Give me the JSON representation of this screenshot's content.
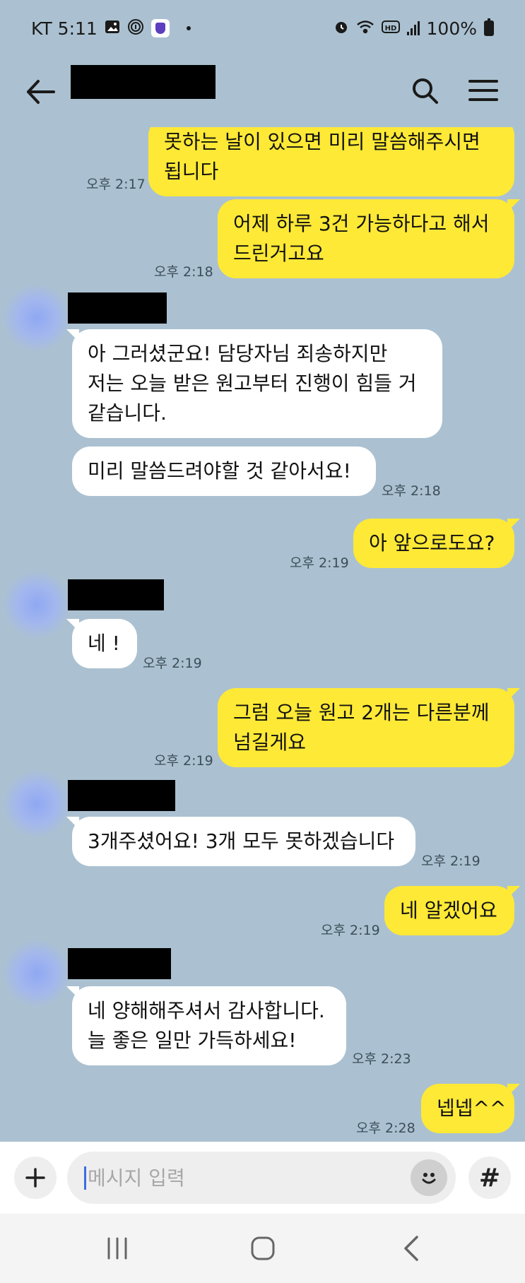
{
  "status_bar": {
    "carrier_time": "KT 5:11",
    "battery": "100%",
    "icons": [
      "gallery-icon",
      "fingerprint-icon",
      "shield-icon",
      "alarm-icon",
      "wifi-icon",
      "hd-icon",
      "signal-icon",
      "battery-icon"
    ]
  },
  "header": {
    "icons": [
      "back-arrow-icon",
      "search-icon",
      "menu-icon"
    ]
  },
  "messages": [
    {
      "from": "me",
      "lines": [
        "못하는 날이 있으면 미리 말씀해주시면",
        "됩니다"
      ],
      "time": "오후 2:17"
    },
    {
      "from": "me",
      "lines": [
        "어제 하루 3건 가능하다고 해서",
        "드린거고요"
      ],
      "time": "오후 2:18"
    },
    {
      "from": "them",
      "lines": [
        "아 그러셨군요! 담당자님 죄송하지만",
        "저는 오늘 받은 원고부터 진행이 힘들 거",
        "같습니다."
      ]
    },
    {
      "from": "them",
      "lines": [
        "미리 말씀드려야할 것 같아서요!"
      ],
      "time": "오후 2:18"
    },
    {
      "from": "me",
      "lines": [
        "아 앞으로도요?"
      ],
      "time": "오후 2:19"
    },
    {
      "from": "them",
      "lines": [
        "네 !"
      ],
      "time": "오후 2:19"
    },
    {
      "from": "me",
      "lines": [
        "그럼 오늘 원고 2개는 다른분께",
        "넘길게요"
      ],
      "time": "오후 2:19"
    },
    {
      "from": "them",
      "lines": [
        "3개주셨어요! 3개 모두 못하겠습니다"
      ],
      "time": "오후 2:19"
    },
    {
      "from": "me",
      "lines": [
        "네 알겠어요"
      ],
      "time": "오후 2:19"
    },
    {
      "from": "them",
      "lines": [
        "네 양해해주셔서 감사합니다.",
        "늘 좋은 일만 가득하세요!"
      ],
      "time": "오후 2:23"
    },
    {
      "from": "me",
      "lines": [
        "넵넵^^"
      ],
      "time": "오후 2:28"
    }
  ],
  "input": {
    "placeholder": "메시지 입력",
    "icons": [
      "plus-icon",
      "emoji-icon",
      "hashtag-icon"
    ],
    "hash_label": "#"
  },
  "nav_bar": {
    "icons": [
      "recent-apps-icon",
      "home-icon",
      "back-icon"
    ]
  },
  "colors": {
    "background": "#abc1d1",
    "my_bubble": "#fee936",
    "their_bubble": "#ffffff",
    "cursor": "#3b6fe0"
  }
}
